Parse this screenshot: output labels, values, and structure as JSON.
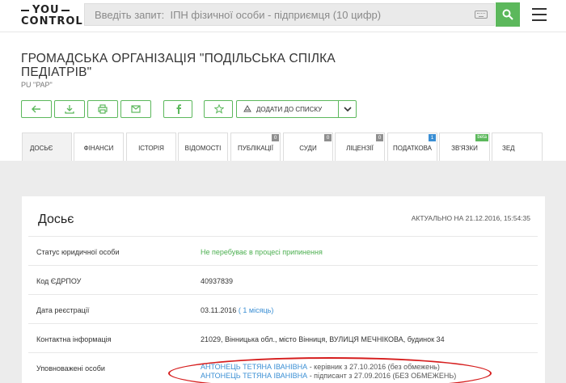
{
  "header": {
    "logo_top": "YOU",
    "logo_bottom": "CONTROL",
    "search_placeholder": "Введіть запит:  ІПН фізичної особи - підприємця (10 цифр)"
  },
  "company": {
    "title": "ГРОМАДСЬКА ОРГАНІЗАЦІЯ \"ПОДІЛЬСЬКА СПІЛКА ПЕДІАТРІВ\"",
    "short_name": "PU \"PAP\""
  },
  "toolbar": {
    "add_to_list_label": "ДОДАТИ ДО СПИСКУ"
  },
  "tabs": [
    {
      "label": "ДОСЬЄ",
      "badge": ""
    },
    {
      "label": "ФІНАНСИ",
      "badge": ""
    },
    {
      "label": "ІСТОРІЯ",
      "badge": ""
    },
    {
      "label": "ВІДОМОСТІ",
      "badge": ""
    },
    {
      "label": "ПУБЛІКАЦІЇ",
      "badge": "0"
    },
    {
      "label": "СУДИ",
      "badge": "0"
    },
    {
      "label": "ЛІЦЕНЗІЇ",
      "badge": "0"
    },
    {
      "label": "ПОДАТКОВА",
      "badge": "1"
    },
    {
      "label": "ЗВ'ЯЗКИ",
      "badge": "beta"
    },
    {
      "label": "ЗЕД",
      "badge": ""
    }
  ],
  "dossier": {
    "title": "Досьє",
    "actual_label": "АКТУАЛЬНО НА 21.12.2016, 15:54:35",
    "rows": [
      {
        "key": "Статус юридичної особи",
        "value": "Не перебуває в процесі припинення"
      },
      {
        "key": "Код ЄДРПОУ",
        "value": "40937839"
      },
      {
        "key": "Дата реєстрації",
        "value": "03.11.2016",
        "value_extra": "( 1 місяць)"
      },
      {
        "key": "Контактна інформація",
        "value": "21029, Вінницька обл., місто Вінниця, ВУЛИЦЯ МЕЧНІКОВА, будинок 34"
      },
      {
        "key": "Уповноважені особи"
      }
    ],
    "persons": [
      {
        "name": "АНТОНЕЦЬ ТЕТЯНА ІВАНІВНА",
        "role": " - керівник з 27.10.2016 (без обмежень)"
      },
      {
        "name": "АНТОНЕЦЬ ТЕТЯНА ІВАНІВНА",
        "role": " - підписант з 27.09.2016 (БЕЗ ОБМЕЖЕНЬ)"
      }
    ]
  },
  "colors": {
    "accent_green": "#5cb85c",
    "link_blue": "#3b8fd4",
    "annotation_red": "#d61e1e"
  }
}
